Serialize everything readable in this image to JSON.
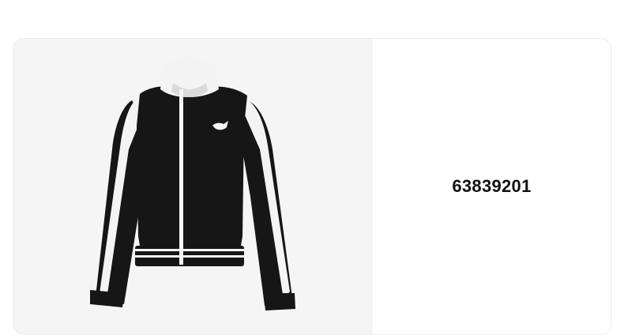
{
  "product": {
    "sku": "63839201",
    "image_subject": "jacket-icon",
    "colors": {
      "jacket_body": "#161616",
      "jacket_stripe": "#f4f4f4",
      "image_background": "#f5f5f5",
      "text": "#111111"
    }
  }
}
